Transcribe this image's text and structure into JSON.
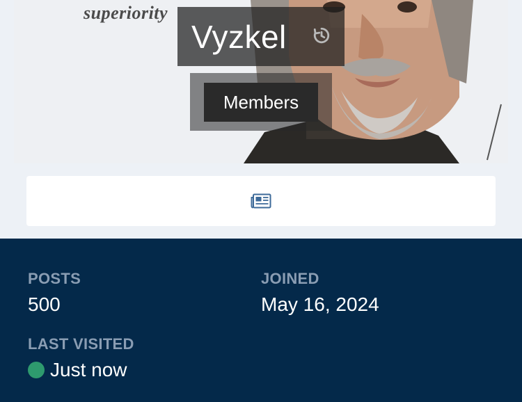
{
  "cover": {
    "caption": "superiority"
  },
  "profile": {
    "username": "Vyzkel",
    "group": "Members",
    "history_icon": "history-icon"
  },
  "tabs": {
    "activity_icon": "newspaper-icon"
  },
  "stats": {
    "posts_label": "POSTS",
    "posts_value": "500",
    "joined_label": "JOINED",
    "joined_value": "May 16, 2024",
    "last_visited_label": "LAST VISITED",
    "last_visited_value": "Just now",
    "online_color": "#2e9a6e"
  },
  "colors": {
    "panel_bg": "#04294a",
    "label": "#8a9db3",
    "page_bg": "#edf1f6"
  }
}
